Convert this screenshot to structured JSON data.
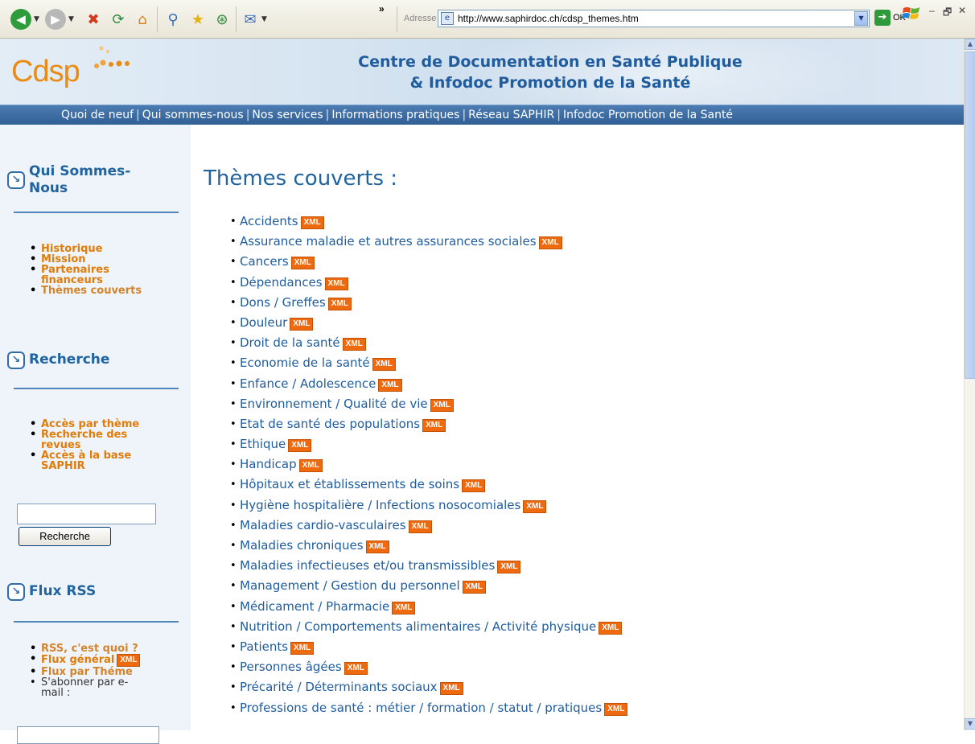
{
  "browser": {
    "more_chevrons": "»",
    "address_label": "Adresse",
    "url": "http://www.saphirdoc.ch/cdsp_themes.htm",
    "go_label": "OK",
    "min_label": "–",
    "restore_label": "🗗",
    "close_label": "✕"
  },
  "header": {
    "logo_text": "Cdsp",
    "title_line1": "Centre de Documentation en Santé Publique",
    "title_line2": "& Infodoc Promotion de la Santé"
  },
  "nav": [
    "Quoi de neuf",
    "Qui sommes-nous",
    "Nos services",
    "Informations pratiques",
    "Réseau SAPHIR",
    "Infodoc Promotion de la Santé"
  ],
  "sidebar": {
    "about": {
      "title": "Qui Sommes-Nous",
      "items": [
        "Historique",
        "Mission",
        "Partenaires financeurs",
        "Thèmes couverts"
      ]
    },
    "search": {
      "title": "Recherche",
      "items": [
        "Accès par thème",
        "Recherche des revues",
        "Accès à la base SAPHIR"
      ],
      "input_value": "",
      "button_label": "Recherche"
    },
    "rss": {
      "title": "Flux RSS",
      "items": [
        "RSS, c'est quoi ?",
        "Flux général",
        "Flux par Théme",
        "S'abonner par e-mail :"
      ],
      "xml_label": "XML"
    }
  },
  "main": {
    "title": "Thèmes couverts :",
    "xml_label": "XML",
    "themes": [
      "Accidents",
      "Assurance maladie et autres assurances sociales",
      "Cancers",
      "Dépendances",
      "Dons / Greffes",
      "Douleur",
      "Droit de la santé",
      "Economie de la santé",
      "Enfance / Adolescence",
      "Environnement / Qualité de vie",
      "Etat de santé des populations",
      "Ethique",
      "Handicap",
      "Hôpitaux et établissements de soins",
      "Hygiène hospitalière / Infections nosocomiales",
      "Maladies cardio-vasculaires",
      "Maladies chroniques",
      "Maladies infectieuses et/ou transmissibles",
      "Management / Gestion du personnel",
      "Médicament / Pharmacie",
      "Nutrition / Comportements alimentaires / Activité physique",
      "Patients",
      "Personnes âgées",
      "Précarité / Déterminants sociaux",
      "Professions de santé : métier / formation / statut / pratiques"
    ]
  },
  "colors": {
    "accent_blue": "#1f5c9e",
    "link_orange": "#e07c0a",
    "xml_badge": "#ef6a0f"
  }
}
